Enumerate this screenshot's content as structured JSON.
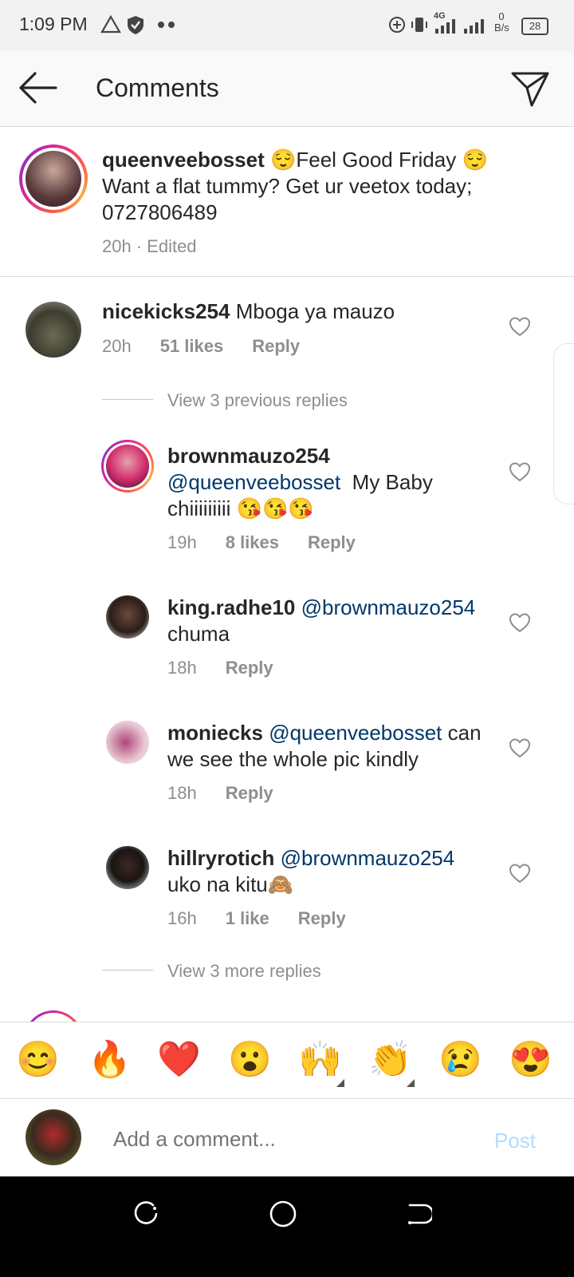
{
  "status_bar": {
    "time": "1:09 PM",
    "net_speed": "0",
    "net_unit": "B/s",
    "battery": "28",
    "network": "4G"
  },
  "header": {
    "title": "Comments"
  },
  "caption": {
    "username": "queenveebosset",
    "line1": "Feel Good Friday",
    "line2": "Want a flat tummy? Get ur veetox today;",
    "line3": "0727806489",
    "emoji": "😌",
    "time": "20h",
    "edited": "· Edited"
  },
  "comment": {
    "username": "nicekicks254",
    "text": "Mboga ya mauzo",
    "time": "20h",
    "likes": "51 likes",
    "reply": "Reply",
    "view_previous": "View 3 previous replies",
    "view_more": "View 3 more replies"
  },
  "replies": [
    {
      "username": "brownmauzo254",
      "mention": "@queenveebosset",
      "text_a": "My Baby",
      "text_b": "chiiiiiiiii",
      "emoji": "😘😘😘",
      "time": "19h",
      "likes": "8 likes",
      "reply": "Reply"
    },
    {
      "username": "king.radhe10",
      "mention": "@brownmauzo254",
      "text": "chuma",
      "time": "18h",
      "reply": "Reply"
    },
    {
      "username": "moniecks",
      "mention": "@queenveebosset",
      "text_a": "can",
      "text_b": "we see the whole pic kindly",
      "time": "18h",
      "reply": "Reply"
    },
    {
      "username": "hillryrotich",
      "mention": "@brownmauzo254",
      "text": "uko na kitu",
      "emoji": "🙈",
      "time": "16h",
      "likes": "1 like",
      "reply": "Reply"
    }
  ],
  "emoji_bar": [
    "😊",
    "🔥",
    "❤️",
    "😮",
    "🙌",
    "👏",
    "😢",
    "😍"
  ],
  "composer": {
    "placeholder": "Add a comment...",
    "post": "Post"
  },
  "colors": {
    "link": "#00376b",
    "post_disabled": "#b3dbff",
    "meta": "#8e8e8e"
  }
}
